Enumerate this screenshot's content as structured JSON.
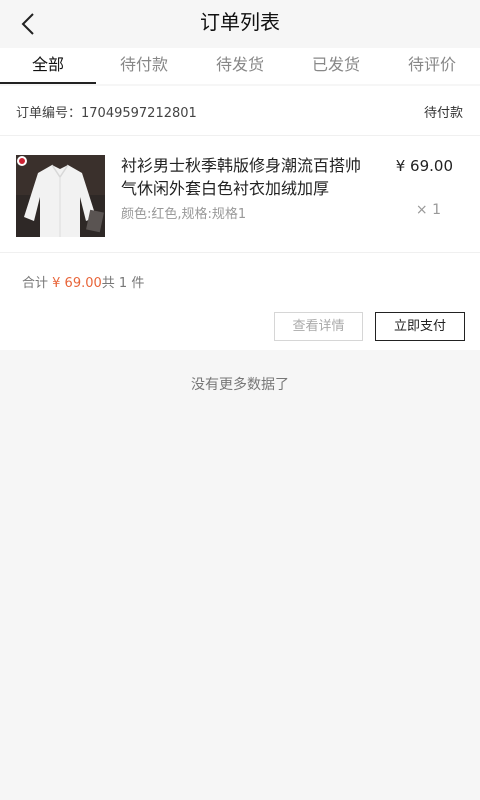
{
  "header": {
    "title": "订单列表",
    "back_icon": "chevron-left-icon"
  },
  "tabs": [
    {
      "label": "全部",
      "active": true
    },
    {
      "label": "待付款",
      "active": false
    },
    {
      "label": "待发货",
      "active": false
    },
    {
      "label": "已发货",
      "active": false
    },
    {
      "label": "待评价",
      "active": false
    }
  ],
  "orders": [
    {
      "number_label": "订单编号：",
      "number": "17049597212801",
      "status": "待付款",
      "items": [
        {
          "name": "衬衫男士秋季韩版修身潮流百搭帅气休闲外套白色衬衣加绒加厚",
          "spec": "颜色:红色,规格:规格1",
          "price": "¥ 69.00",
          "qty": "× 1"
        }
      ],
      "summary": {
        "total_label": "合计",
        "total": "¥ 69.00",
        "count": "共 1 件"
      },
      "actions": {
        "detail": "查看详情",
        "pay": "立即支付"
      }
    }
  ],
  "footer": {
    "no_more": "没有更多数据了"
  },
  "colors": {
    "accent_price": "#e8653a",
    "background": "#f6f6f6"
  }
}
